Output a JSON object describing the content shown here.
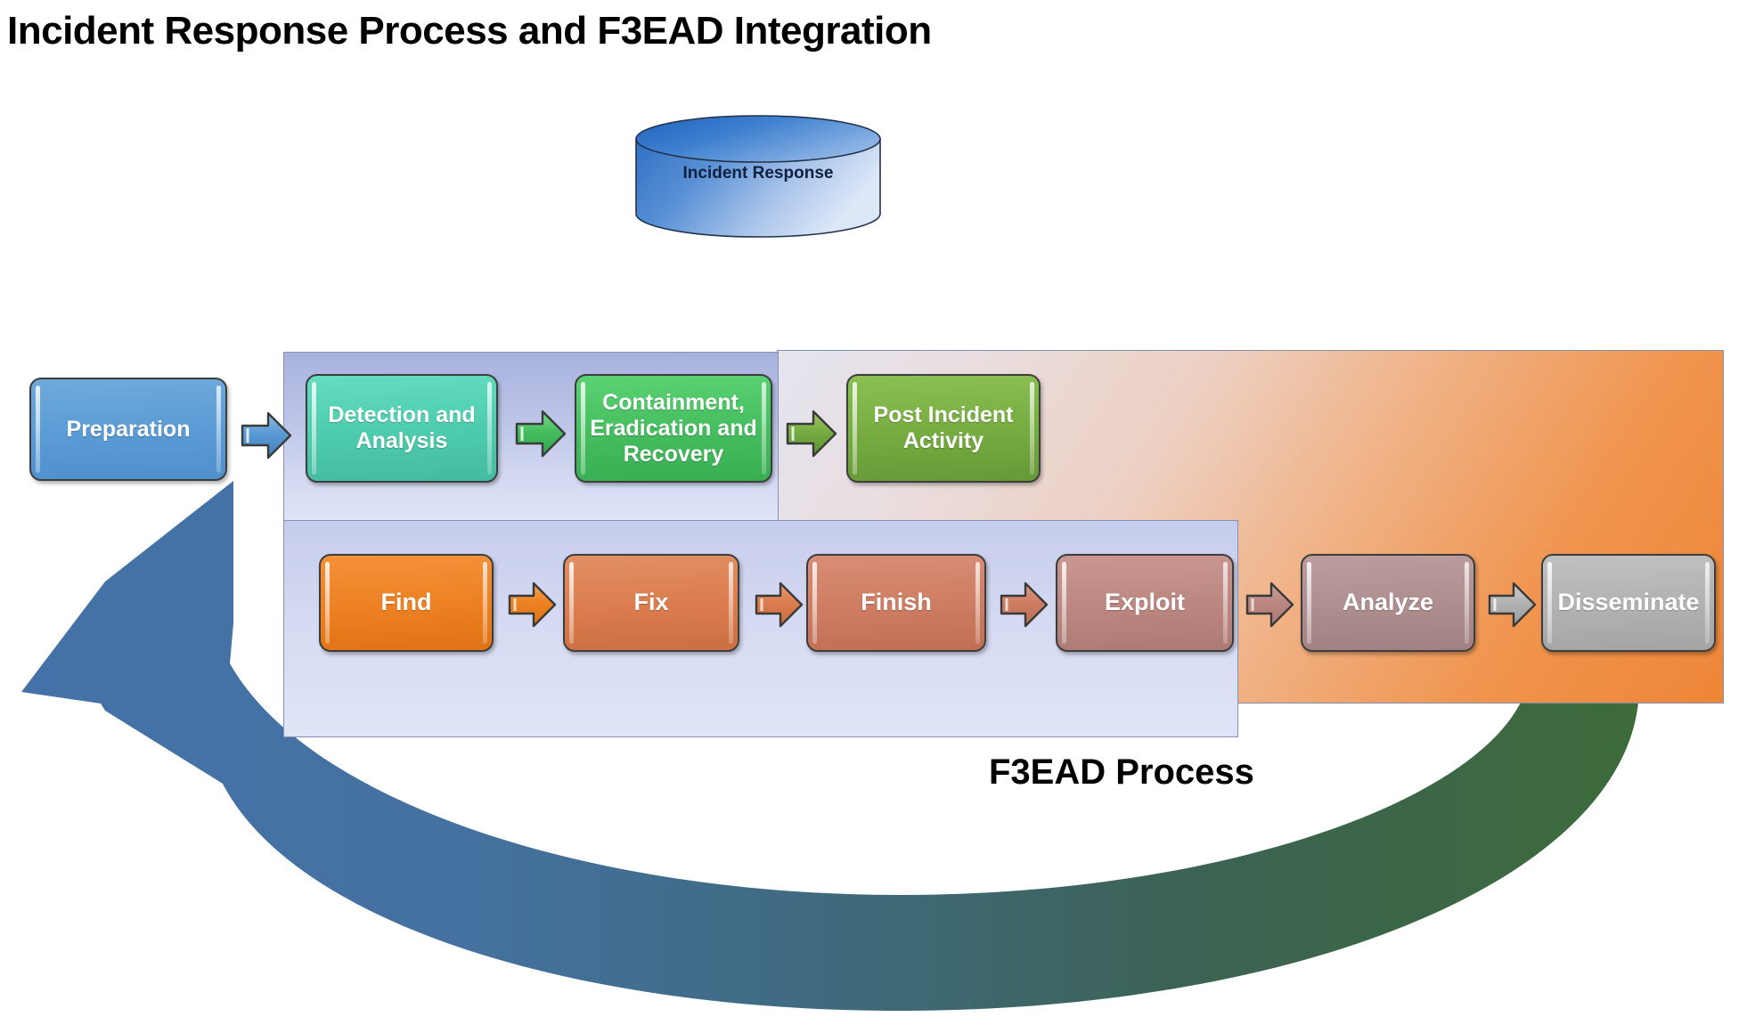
{
  "title": "Incident Response Process and F3EAD Integration",
  "cylinder": {
    "label": "Incident Response",
    "top_color": "#2E75C8",
    "bottom_color": "#D9E4F7"
  },
  "panels": {
    "incident_response": {
      "name": "Incident Response panel",
      "fill_top": "#A8B2DE",
      "fill_bottom": "#E0E4F7"
    },
    "f3ead": {
      "name": "F3EAD panel",
      "caption": "F3EAD Process",
      "fill_start": "#E5E4EF",
      "fill_end": "#EE8537"
    }
  },
  "ir_steps": [
    {
      "label": "Preparation",
      "color": "#5B9BD5"
    },
    {
      "label": "Detection and Analysis",
      "color": "#4ECCAE"
    },
    {
      "label": "Containment, Eradication and Recovery",
      "color": "#45BE5F"
    },
    {
      "label": "Post Incident Activity",
      "color": "#76AC41"
    }
  ],
  "ir_arrows": [
    {
      "name": "arrow-preparation-to-detection",
      "color": "#5B9BD5"
    },
    {
      "name": "arrow-detection-to-containment",
      "color": "#45BE5F"
    },
    {
      "name": "arrow-containment-to-post",
      "color": "#76AC41"
    }
  ],
  "f3ead_steps": [
    {
      "label": "Find",
      "color": "#ED8123"
    },
    {
      "label": "Fix",
      "color": "#DB7D4E"
    },
    {
      "label": "Finish",
      "color": "#CE7D62"
    },
    {
      "label": "Exploit",
      "color": "#BC8781"
    },
    {
      "label": "Analyze",
      "color": "#AE8E8E"
    },
    {
      "label": "Disseminate",
      "color": "#B2B2B2"
    }
  ],
  "f3ead_arrows": [
    {
      "name": "arrow-find-to-fix",
      "color": "#ED8123"
    },
    {
      "name": "arrow-fix-to-finish",
      "color": "#DB7D4E"
    },
    {
      "name": "arrow-finish-to-exploit",
      "color": "#CE7D62"
    },
    {
      "name": "arrow-exploit-to-analyze",
      "color": "#BC8781"
    },
    {
      "name": "arrow-analyze-to-disseminate",
      "color": "#B2B2B2"
    }
  ],
  "feedback_arrow": {
    "name": "feedback-loop-arrow",
    "start_color": "#3D6B3A",
    "end_color": "#4472A8",
    "direction": "disseminate-back-to-preparation"
  }
}
